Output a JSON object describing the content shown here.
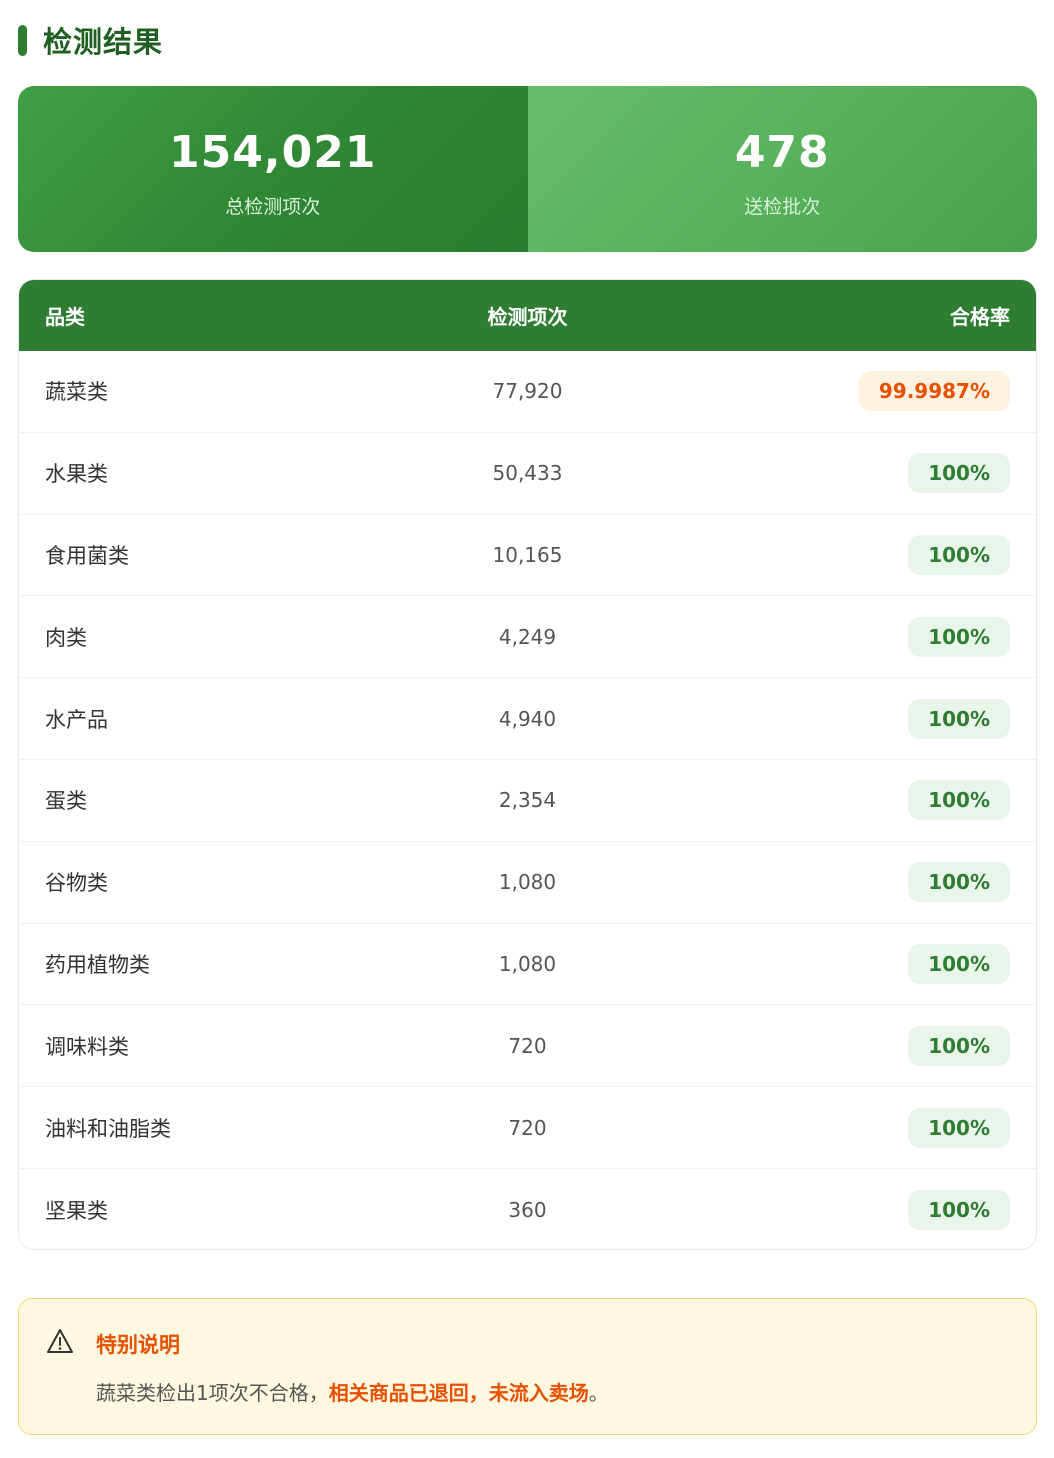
{
  "header": {
    "title": "检测结果"
  },
  "stats": [
    {
      "value": "154,021",
      "label": "总检测项次"
    },
    {
      "value": "478",
      "label": "送检批次"
    }
  ],
  "table": {
    "columns": [
      "品类",
      "检测项次",
      "合格率"
    ],
    "rows": [
      {
        "category": "蔬菜类",
        "count": "77,920",
        "rate": "99.9987%",
        "status": "warn"
      },
      {
        "category": "水果类",
        "count": "50,433",
        "rate": "100%",
        "status": "pass"
      },
      {
        "category": "食用菌类",
        "count": "10,165",
        "rate": "100%",
        "status": "pass"
      },
      {
        "category": "肉类",
        "count": "4,249",
        "rate": "100%",
        "status": "pass"
      },
      {
        "category": "水产品",
        "count": "4,940",
        "rate": "100%",
        "status": "pass"
      },
      {
        "category": "蛋类",
        "count": "2,354",
        "rate": "100%",
        "status": "pass"
      },
      {
        "category": "谷物类",
        "count": "1,080",
        "rate": "100%",
        "status": "pass"
      },
      {
        "category": "药用植物类",
        "count": "1,080",
        "rate": "100%",
        "status": "pass"
      },
      {
        "category": "调味料类",
        "count": "720",
        "rate": "100%",
        "status": "pass"
      },
      {
        "category": "油料和油脂类",
        "count": "720",
        "rate": "100%",
        "status": "pass"
      },
      {
        "category": "坚果类",
        "count": "360",
        "rate": "100%",
        "status": "pass"
      }
    ]
  },
  "notice": {
    "icon": "warning-triangle-icon",
    "title": "特别说明",
    "text_prefix": "蔬菜类检出1项次不合格，",
    "text_emphasis": "相关商品已退回，未流入卖场",
    "text_suffix": "。"
  },
  "colors": {
    "primary": "#2e7d32",
    "pass_bg": "#e9f5ea",
    "warn_text": "#e65100",
    "warn_bg": "#fff1df",
    "notice_bg": "#fff8e1",
    "notice_border": "#f7d77a"
  }
}
